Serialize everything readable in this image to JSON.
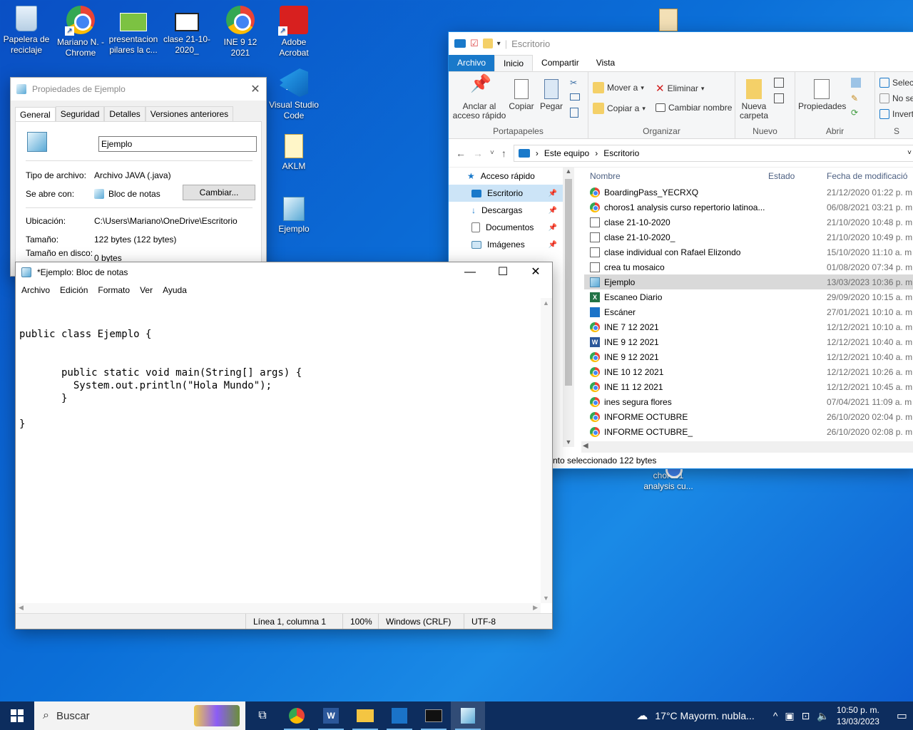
{
  "desktop": {
    "icons": [
      {
        "label": "Papelera de reciclaje",
        "icon": "recycle-bin-icon"
      },
      {
        "label": "Mariano N. - Chrome",
        "icon": "chrome-icon"
      },
      {
        "label": "presentacion pilares la c...",
        "icon": "image-file-icon"
      },
      {
        "label": "clase 21-10-2020_",
        "icon": "document-icon"
      },
      {
        "label": "INE 9 12 2021",
        "icon": "chrome-icon"
      },
      {
        "label": "Adobe Acrobat",
        "icon": "acrobat-icon"
      },
      {
        "label": "Visual Studio Code",
        "icon": "vscode-icon"
      },
      {
        "label": "AKLM",
        "icon": "file-icon"
      },
      {
        "label": "Ejemplo",
        "icon": "notepad-file-icon"
      },
      {
        "label": "choros1 analysis cu...",
        "icon": "chrome-icon"
      }
    ]
  },
  "explorer": {
    "title": "Escritorio",
    "tabs": [
      "Archivo",
      "Inicio",
      "Compartir",
      "Vista"
    ],
    "ribbon": {
      "pin": "Anclar al acceso rápido",
      "copy": "Copiar",
      "paste": "Pegar",
      "clipboard_group": "Portapapeles",
      "move_to": "Mover a",
      "copy_to": "Copiar a",
      "delete": "Eliminar",
      "rename": "Cambiar nombre",
      "organize_group": "Organizar",
      "new_folder": "Nueva carpeta",
      "new_group": "Nuevo",
      "properties": "Propiedades",
      "open_group": "Abrir",
      "select_all": "Selec",
      "select_none": "No se",
      "invert": "Invert",
      "select_group": "S"
    },
    "breadcrumb": [
      "Este equipo",
      "Escritorio"
    ],
    "nav": [
      {
        "label": "Acceso rápido",
        "pinned": false
      },
      {
        "label": "Escritorio",
        "pinned": true
      },
      {
        "label": "Descargas",
        "pinned": true
      },
      {
        "label": "Documentos",
        "pinned": true
      },
      {
        "label": "Imágenes",
        "pinned": true
      }
    ],
    "columns": [
      "Nombre",
      "Estado",
      "Fecha de modificació"
    ],
    "files": [
      {
        "name": "BoardingPass_YECRXQ",
        "date": "21/12/2020 01:22 p. m",
        "type": "chrome"
      },
      {
        "name": "choros1 analysis curso repertorio latinoa...",
        "date": "06/08/2021 03:21 p. m",
        "type": "chrome"
      },
      {
        "name": "clase 21-10-2020",
        "date": "21/10/2020 10:48 p. m",
        "type": "doc"
      },
      {
        "name": "clase 21-10-2020_",
        "date": "21/10/2020 10:49 p. m",
        "type": "doc"
      },
      {
        "name": "clase individual con Rafael Elizondo",
        "date": "15/10/2020 11:10 a. m",
        "type": "doc"
      },
      {
        "name": "crea tu mosaico",
        "date": "01/08/2020 07:34 p. m",
        "type": "doc"
      },
      {
        "name": "Ejemplo",
        "date": "13/03/2023 10:36 p. m",
        "type": "note"
      },
      {
        "name": "Escaneo Diario",
        "date": "29/09/2020 10:15 a. m",
        "type": "excel"
      },
      {
        "name": "Escáner",
        "date": "27/01/2021 10:10 a. m",
        "type": "scan"
      },
      {
        "name": "INE 7 12 2021",
        "date": "12/12/2021 10:10 a. m",
        "type": "chrome"
      },
      {
        "name": "INE 9 12 2021",
        "date": "12/12/2021 10:40 a. m",
        "type": "word"
      },
      {
        "name": "INE 9 12 2021",
        "date": "12/12/2021 10:40 a. m",
        "type": "chrome"
      },
      {
        "name": "INE 10 12 2021",
        "date": "12/12/2021 10:26 a. m",
        "type": "chrome"
      },
      {
        "name": "INE 11 12 2021",
        "date": "12/12/2021 10:45 a. m",
        "type": "chrome"
      },
      {
        "name": "ines segura flores",
        "date": "07/04/2021 11:09 a. m",
        "type": "chrome"
      },
      {
        "name": "INFORME OCTUBRE",
        "date": "26/10/2020 02:04 p. m",
        "type": "chrome"
      },
      {
        "name": "INFORME OCTUBRE_",
        "date": "26/10/2020 02:08 p. m",
        "type": "chrome"
      }
    ],
    "status": "nto seleccionado  122 bytes"
  },
  "properties": {
    "title": "Propiedades de Ejemplo",
    "tabs": [
      "General",
      "Seguridad",
      "Detalles",
      "Versiones anteriores"
    ],
    "filename": "Ejemplo",
    "file_type_label": "Tipo de archivo:",
    "file_type": "Archivo JAVA (.java)",
    "opens_with_label": "Se abre con:",
    "opens_with": "Bloc de notas",
    "change_button": "Cambiar...",
    "location_label": "Ubicación:",
    "location": "C:\\Users\\Mariano\\OneDrive\\Escritorio",
    "size_label": "Tamaño:",
    "size": "122 bytes (122 bytes)",
    "disk_size_label": "Tamaño en disco:",
    "disk_size": "0 bytes"
  },
  "notepad": {
    "title": "*Ejemplo: Bloc de notas",
    "menu": [
      "Archivo",
      "Edición",
      "Formato",
      "Ver",
      "Ayuda"
    ],
    "content": "\n\npublic class Ejemplo {\n\n\n       public static void main(String[] args) {\n         System.out.println(\"Hola Mundo\");\n       }\n\n}",
    "status": {
      "position": "Línea 1, columna 1",
      "zoom": "100%",
      "line_endings": "Windows (CRLF)",
      "encoding": "UTF-8"
    }
  },
  "taskbar": {
    "search_placeholder": "Buscar",
    "weather": "17°C  Mayorm. nubla...",
    "time": "10:50 p. m.",
    "date": "13/03/2023"
  }
}
